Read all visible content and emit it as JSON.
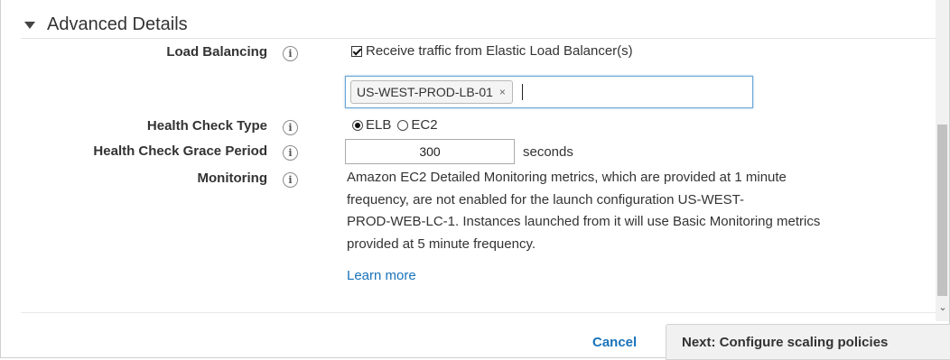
{
  "section": {
    "title": "Advanced Details"
  },
  "info_glyph": "i",
  "load_balancing": {
    "label": "Load Balancing",
    "checkbox_label": "Receive traffic from Elastic Load Balancer(s)",
    "checked": true,
    "selected_tags": [
      "US-WEST-PROD-LB-01"
    ],
    "tag_remove_glyph": "×"
  },
  "health_check_type": {
    "label": "Health Check Type",
    "options": [
      "ELB",
      "EC2"
    ],
    "selected": "ELB"
  },
  "grace_period": {
    "label": "Health Check Grace Period",
    "value": "300",
    "unit": "seconds"
  },
  "monitoring": {
    "label": "Monitoring",
    "lines": [
      "Amazon EC2 Detailed Monitoring metrics, which are provided at 1 minute",
      "frequency, are not enabled for the launch configuration US-WEST-",
      "PROD-WEB-LC-1. Instances launched from it will use Basic Monitoring metrics",
      "provided at 5 minute frequency."
    ],
    "learn_more": "Learn more"
  },
  "footer": {
    "cancel": "Cancel",
    "next": "Next: Configure scaling policies"
  },
  "colors": {
    "link": "#1a73ba",
    "focus_border": "#6aa6d9"
  },
  "icons": {
    "caret": "caret-down-icon",
    "info": "info-icon",
    "scroll": "chevron-down-icon"
  }
}
